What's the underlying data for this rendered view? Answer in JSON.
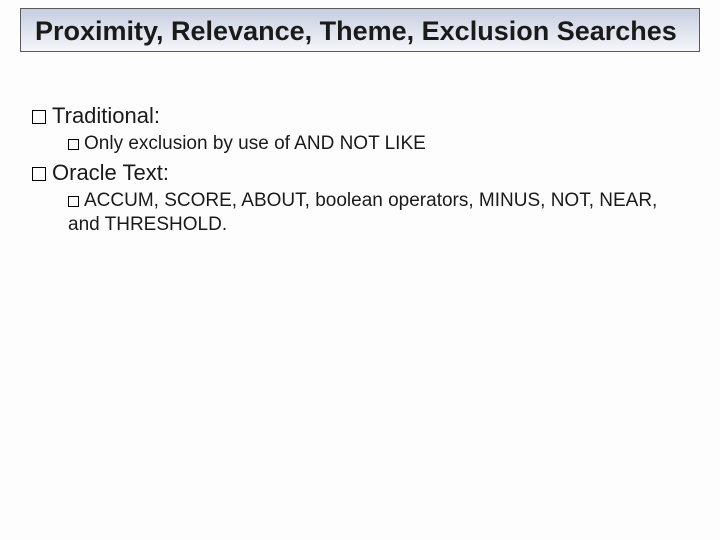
{
  "title": "Proximity, Relevance, Theme, Exclusion Searches",
  "bullets": [
    {
      "label": "Traditional:",
      "children": [
        {
          "label": "Only exclusion by use of AND NOT LIKE"
        }
      ]
    },
    {
      "label": "Oracle Text:",
      "children": [
        {
          "label": "ACCUM, SCORE, ABOUT, boolean operators, MINUS, NOT, NEAR, and THRESHOLD."
        }
      ]
    }
  ]
}
